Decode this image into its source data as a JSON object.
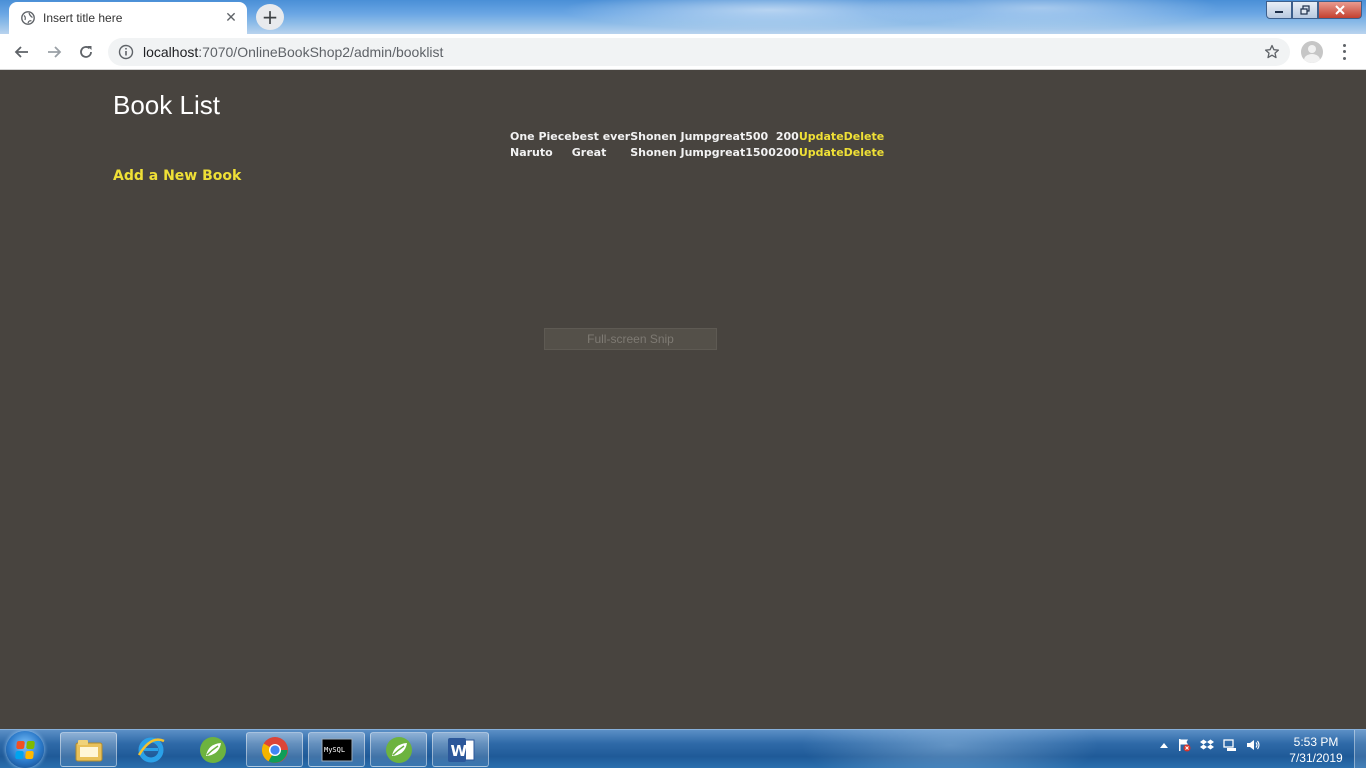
{
  "browser": {
    "tab_title": "Insert title here",
    "tab_close_glyph": "✕",
    "new_tab_glyph": "+",
    "url_host": "localhost",
    "url_path": ":7070/OnlineBookShop2/admin/booklist"
  },
  "page": {
    "title": "Book List",
    "books": [
      {
        "name": "One Piece",
        "description": "best ever",
        "publisher": "Shonen Jump",
        "review": "great",
        "price": "500",
        "quantity": "200",
        "update_label": "Update",
        "delete_label": "Delete"
      },
      {
        "name": "Naruto",
        "description": "Great",
        "publisher": "Shonen Jump",
        "review": "great",
        "price": "1500",
        "quantity": "200",
        "update_label": "Update",
        "delete_label": "Delete"
      }
    ],
    "add_link": "Add a New Book",
    "overlay_label": "Full-screen Snip"
  },
  "taskbar": {
    "apps": [
      "file-explorer-icon",
      "internet-explorer-icon",
      "spring-tool-suite-icon",
      "chrome-icon",
      "mysql-console-icon",
      "spring-tool-suite-icon",
      "word-icon"
    ],
    "mysql_label": "MySQL",
    "word_letter": "W",
    "time": "5:53 PM",
    "date": "7/31/2019"
  },
  "colors": {
    "page_background": "#48443f",
    "link_yellow": "#efe036",
    "text_white": "#f2f2f2"
  }
}
